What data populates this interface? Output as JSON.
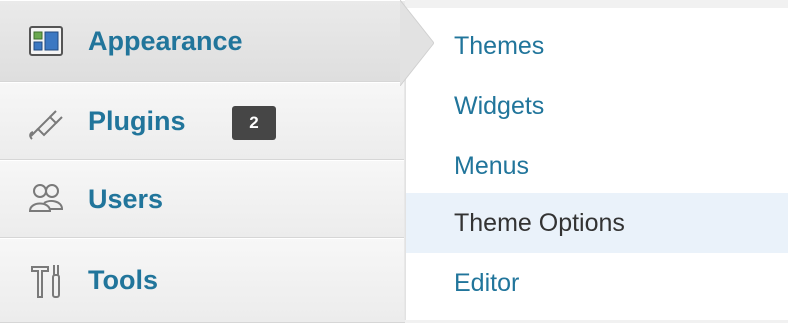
{
  "side_menu": {
    "items": [
      {
        "label": "Appearance",
        "icon": "appearance-icon",
        "current": true
      },
      {
        "label": "Plugins",
        "icon": "plugin-icon",
        "badge": "2"
      },
      {
        "label": "Users",
        "icon": "users-icon"
      },
      {
        "label": "Tools",
        "icon": "tools-icon"
      }
    ]
  },
  "submenu": {
    "items": [
      {
        "label": "Themes"
      },
      {
        "label": "Widgets"
      },
      {
        "label": "Menus"
      },
      {
        "label": "Theme Options",
        "hovered": true
      },
      {
        "label": "Editor"
      }
    ]
  },
  "colors": {
    "link": "#21759b",
    "menu_bg": "#f1f1f1",
    "current_bg": "#e4e4e4",
    "hover_bg": "#eaf2fa",
    "badge_bg": "#464646"
  }
}
